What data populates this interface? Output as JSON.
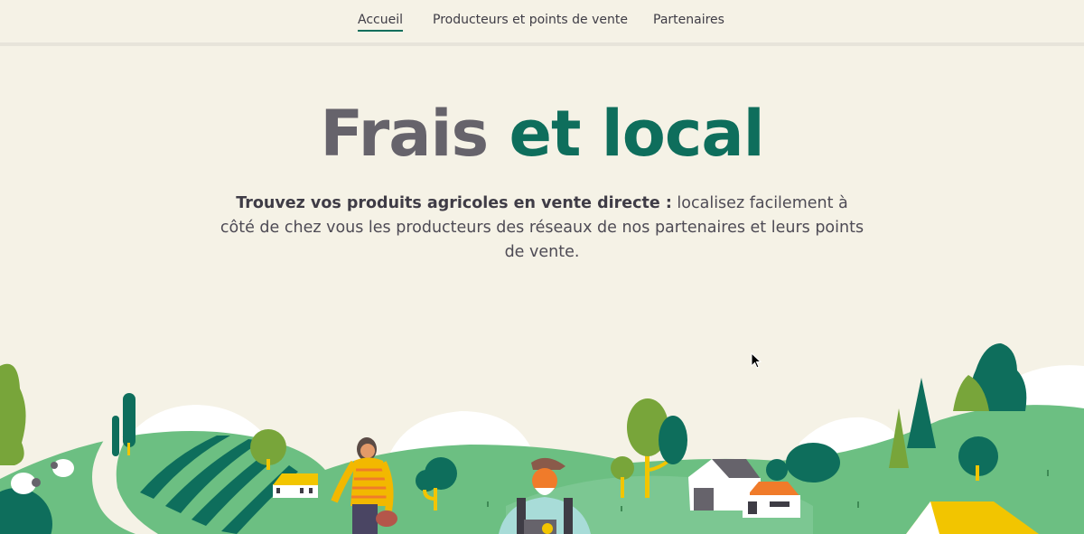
{
  "nav": {
    "items": [
      {
        "label": "Accueil",
        "active": true
      },
      {
        "label": "Producteurs et points de vente",
        "active": false
      },
      {
        "label": "Partenaires",
        "active": false
      }
    ]
  },
  "hero": {
    "title_part1": "Frais",
    "title_part2": "et local",
    "subtitle_bold": "Trouvez vos produits agricoles en vente directe :",
    "subtitle_rest": " localisez facilement à côté de chez vous les producteurs des réseaux de nos partenaires et leurs points de vente."
  },
  "colors": {
    "background": "#f5f2e6",
    "accent_green": "#0e6e5c",
    "title_gray": "#66636b",
    "hill_green": "#6cbf82",
    "tree_olive": "#78a53a",
    "roof_yellow": "#f2c500",
    "roof_orange": "#f07b2a"
  },
  "illustration": {
    "name": "countryside-landscape"
  }
}
